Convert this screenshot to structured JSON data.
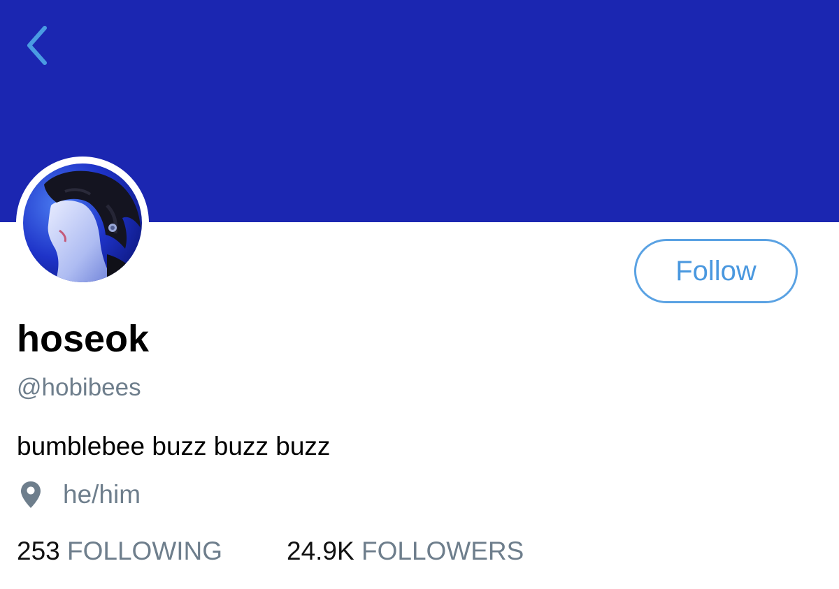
{
  "header": {
    "banner_color": "#1b26b1",
    "back_icon": "chevron-left-icon"
  },
  "profile": {
    "avatar": "profile-photo",
    "display_name": "hoseok",
    "handle": "@hobibees",
    "bio": "bumblebee buzz buzz buzz",
    "location_icon": "location-pin-icon",
    "location": "he/him",
    "follow_label": "Follow"
  },
  "stats": {
    "following_count": "253",
    "following_label": "FOLLOWING",
    "followers_count": "24.9K",
    "followers_label": "FOLLOWERS"
  },
  "colors": {
    "accent": "#4a98df",
    "secondary_text": "#6e7e8c",
    "primary_text": "#000000"
  }
}
